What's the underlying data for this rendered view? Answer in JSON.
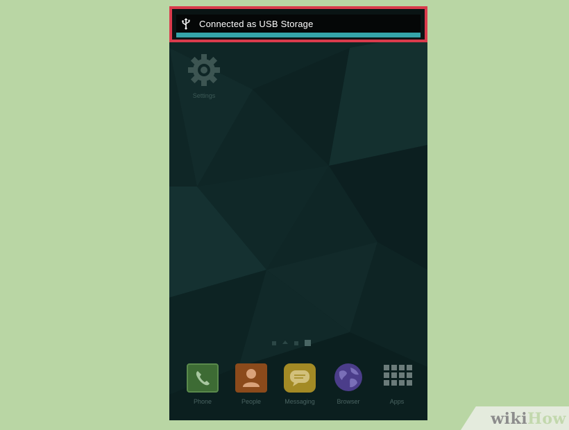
{
  "notification": {
    "text": "Connected as USB Storage",
    "icon": "usb-icon",
    "highlight_color": "#d93b4c",
    "stripe_color": "#35a4a9"
  },
  "home_apps": [
    {
      "label": "Settings",
      "icon": "gear-icon"
    }
  ],
  "page_indicator": {
    "pages": 4,
    "home_index": 1,
    "active_index": 3
  },
  "dock": [
    {
      "label": "Phone",
      "icon": "phone-icon"
    },
    {
      "label": "People",
      "icon": "people-icon"
    },
    {
      "label": "Messaging",
      "icon": "messaging-icon"
    },
    {
      "label": "Browser",
      "icon": "globe-icon"
    },
    {
      "label": "Apps",
      "icon": "apps-grid-icon"
    }
  ],
  "watermark": {
    "wiki": "wiki",
    "how": "How"
  }
}
